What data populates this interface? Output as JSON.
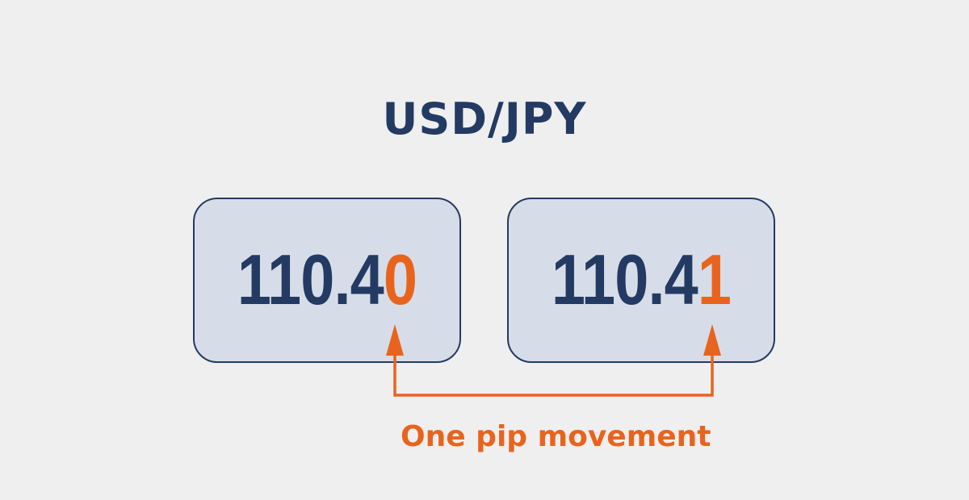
{
  "title": "USD/JPY",
  "quotes": [
    {
      "base": "110.4",
      "pip_digit": "0"
    },
    {
      "base": "110.4",
      "pip_digit": "1"
    }
  ],
  "caption": "One pip movement",
  "colors": {
    "background": "#efefef",
    "navy": "#233a63",
    "box_fill": "#d7dde8",
    "accent": "#e8641e"
  }
}
